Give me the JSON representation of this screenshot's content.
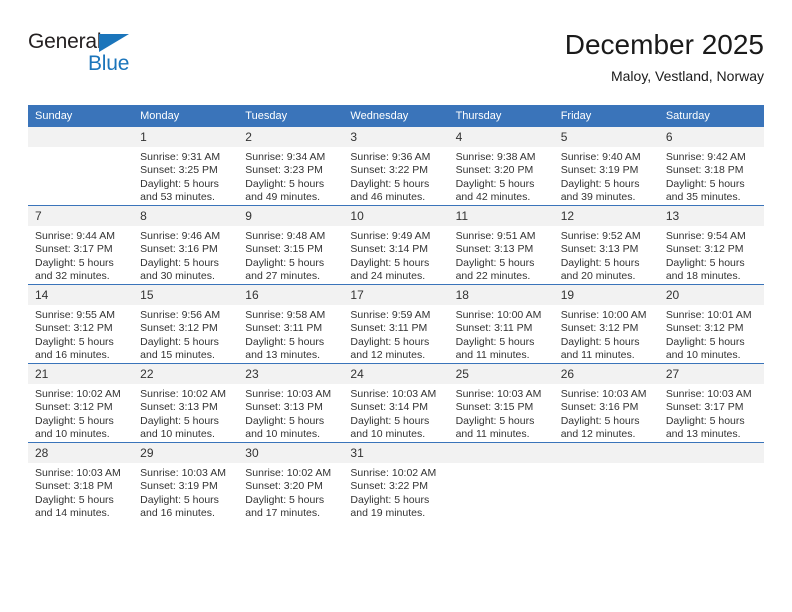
{
  "brand": {
    "name_top": "General",
    "name_bottom": "Blue",
    "accent_color": "#1b75bb"
  },
  "header": {
    "title": "December 2025",
    "subtitle": "Maloy, Vestland, Norway"
  },
  "calendar": {
    "header_color": "#3a74ba",
    "daynum_band_color": "#f2f2f2",
    "weekday_headers": [
      "Sunday",
      "Monday",
      "Tuesday",
      "Wednesday",
      "Thursday",
      "Friday",
      "Saturday"
    ],
    "weeks": [
      [
        {
          "day": "",
          "lines": []
        },
        {
          "day": "1",
          "lines": [
            "Sunrise: 9:31 AM",
            "Sunset: 3:25 PM",
            "Daylight: 5 hours",
            "and 53 minutes."
          ]
        },
        {
          "day": "2",
          "lines": [
            "Sunrise: 9:34 AM",
            "Sunset: 3:23 PM",
            "Daylight: 5 hours",
            "and 49 minutes."
          ]
        },
        {
          "day": "3",
          "lines": [
            "Sunrise: 9:36 AM",
            "Sunset: 3:22 PM",
            "Daylight: 5 hours",
            "and 46 minutes."
          ]
        },
        {
          "day": "4",
          "lines": [
            "Sunrise: 9:38 AM",
            "Sunset: 3:20 PM",
            "Daylight: 5 hours",
            "and 42 minutes."
          ]
        },
        {
          "day": "5",
          "lines": [
            "Sunrise: 9:40 AM",
            "Sunset: 3:19 PM",
            "Daylight: 5 hours",
            "and 39 minutes."
          ]
        },
        {
          "day": "6",
          "lines": [
            "Sunrise: 9:42 AM",
            "Sunset: 3:18 PM",
            "Daylight: 5 hours",
            "and 35 minutes."
          ]
        }
      ],
      [
        {
          "day": "7",
          "lines": [
            "Sunrise: 9:44 AM",
            "Sunset: 3:17 PM",
            "Daylight: 5 hours",
            "and 32 minutes."
          ]
        },
        {
          "day": "8",
          "lines": [
            "Sunrise: 9:46 AM",
            "Sunset: 3:16 PM",
            "Daylight: 5 hours",
            "and 30 minutes."
          ]
        },
        {
          "day": "9",
          "lines": [
            "Sunrise: 9:48 AM",
            "Sunset: 3:15 PM",
            "Daylight: 5 hours",
            "and 27 minutes."
          ]
        },
        {
          "day": "10",
          "lines": [
            "Sunrise: 9:49 AM",
            "Sunset: 3:14 PM",
            "Daylight: 5 hours",
            "and 24 minutes."
          ]
        },
        {
          "day": "11",
          "lines": [
            "Sunrise: 9:51 AM",
            "Sunset: 3:13 PM",
            "Daylight: 5 hours",
            "and 22 minutes."
          ]
        },
        {
          "day": "12",
          "lines": [
            "Sunrise: 9:52 AM",
            "Sunset: 3:13 PM",
            "Daylight: 5 hours",
            "and 20 minutes."
          ]
        },
        {
          "day": "13",
          "lines": [
            "Sunrise: 9:54 AM",
            "Sunset: 3:12 PM",
            "Daylight: 5 hours",
            "and 18 minutes."
          ]
        }
      ],
      [
        {
          "day": "14",
          "lines": [
            "Sunrise: 9:55 AM",
            "Sunset: 3:12 PM",
            "Daylight: 5 hours",
            "and 16 minutes."
          ]
        },
        {
          "day": "15",
          "lines": [
            "Sunrise: 9:56 AM",
            "Sunset: 3:12 PM",
            "Daylight: 5 hours",
            "and 15 minutes."
          ]
        },
        {
          "day": "16",
          "lines": [
            "Sunrise: 9:58 AM",
            "Sunset: 3:11 PM",
            "Daylight: 5 hours",
            "and 13 minutes."
          ]
        },
        {
          "day": "17",
          "lines": [
            "Sunrise: 9:59 AM",
            "Sunset: 3:11 PM",
            "Daylight: 5 hours",
            "and 12 minutes."
          ]
        },
        {
          "day": "18",
          "lines": [
            "Sunrise: 10:00 AM",
            "Sunset: 3:11 PM",
            "Daylight: 5 hours",
            "and 11 minutes."
          ]
        },
        {
          "day": "19",
          "lines": [
            "Sunrise: 10:00 AM",
            "Sunset: 3:12 PM",
            "Daylight: 5 hours",
            "and 11 minutes."
          ]
        },
        {
          "day": "20",
          "lines": [
            "Sunrise: 10:01 AM",
            "Sunset: 3:12 PM",
            "Daylight: 5 hours",
            "and 10 minutes."
          ]
        }
      ],
      [
        {
          "day": "21",
          "lines": [
            "Sunrise: 10:02 AM",
            "Sunset: 3:12 PM",
            "Daylight: 5 hours",
            "and 10 minutes."
          ]
        },
        {
          "day": "22",
          "lines": [
            "Sunrise: 10:02 AM",
            "Sunset: 3:13 PM",
            "Daylight: 5 hours",
            "and 10 minutes."
          ]
        },
        {
          "day": "23",
          "lines": [
            "Sunrise: 10:03 AM",
            "Sunset: 3:13 PM",
            "Daylight: 5 hours",
            "and 10 minutes."
          ]
        },
        {
          "day": "24",
          "lines": [
            "Sunrise: 10:03 AM",
            "Sunset: 3:14 PM",
            "Daylight: 5 hours",
            "and 10 minutes."
          ]
        },
        {
          "day": "25",
          "lines": [
            "Sunrise: 10:03 AM",
            "Sunset: 3:15 PM",
            "Daylight: 5 hours",
            "and 11 minutes."
          ]
        },
        {
          "day": "26",
          "lines": [
            "Sunrise: 10:03 AM",
            "Sunset: 3:16 PM",
            "Daylight: 5 hours",
            "and 12 minutes."
          ]
        },
        {
          "day": "27",
          "lines": [
            "Sunrise: 10:03 AM",
            "Sunset: 3:17 PM",
            "Daylight: 5 hours",
            "and 13 minutes."
          ]
        }
      ],
      [
        {
          "day": "28",
          "lines": [
            "Sunrise: 10:03 AM",
            "Sunset: 3:18 PM",
            "Daylight: 5 hours",
            "and 14 minutes."
          ]
        },
        {
          "day": "29",
          "lines": [
            "Sunrise: 10:03 AM",
            "Sunset: 3:19 PM",
            "Daylight: 5 hours",
            "and 16 minutes."
          ]
        },
        {
          "day": "30",
          "lines": [
            "Sunrise: 10:02 AM",
            "Sunset: 3:20 PM",
            "Daylight: 5 hours",
            "and 17 minutes."
          ]
        },
        {
          "day": "31",
          "lines": [
            "Sunrise: 10:02 AM",
            "Sunset: 3:22 PM",
            "Daylight: 5 hours",
            "and 19 minutes."
          ]
        },
        {
          "day": "",
          "lines": []
        },
        {
          "day": "",
          "lines": []
        },
        {
          "day": "",
          "lines": []
        }
      ]
    ]
  }
}
